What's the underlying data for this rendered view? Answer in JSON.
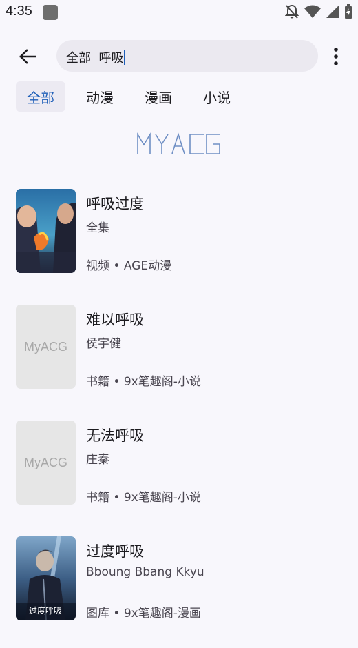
{
  "status_bar": {
    "time": "4:35",
    "icons": [
      "app-notification-icon",
      "bell-off-icon",
      "wifi-icon",
      "signal-icon",
      "battery-icon"
    ]
  },
  "search": {
    "query": "全部  呼吸"
  },
  "tabs": [
    {
      "label": "全部",
      "active": true
    },
    {
      "label": "动漫",
      "active": false
    },
    {
      "label": "漫画",
      "active": false
    },
    {
      "label": "小说",
      "active": false
    }
  ],
  "logo_text": "MYACG",
  "results": [
    {
      "title": "呼吸过度",
      "subtitle": "全集",
      "meta": "视频 • AGE动漫",
      "cover": "image",
      "cover_caption": ""
    },
    {
      "title": "难以呼吸",
      "subtitle": "侯宇健",
      "meta": "书籍 • 9x笔趣阁-小说",
      "cover": "placeholder",
      "cover_caption": "MyACG"
    },
    {
      "title": "无法呼吸",
      "subtitle": "庄秦",
      "meta": "书籍 • 9x笔趣阁-小说",
      "cover": "placeholder",
      "cover_caption": "MyACG"
    },
    {
      "title": "过度呼吸",
      "subtitle": "Bboung Bbang Kkyu",
      "meta": "图库 • 9x笔趣阁-漫画",
      "cover": "image",
      "cover_caption": "过度呼吸"
    }
  ],
  "colors": {
    "accent": "#1f5fb8",
    "background": "#f8f7fc",
    "search_bg": "#ebe9f0",
    "placeholder_bg": "#e6e6e6"
  }
}
